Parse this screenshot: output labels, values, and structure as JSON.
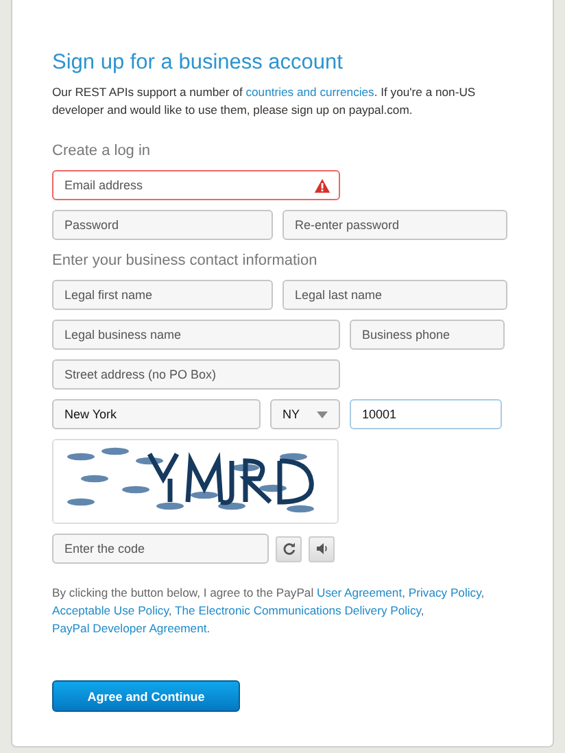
{
  "title": "Sign up for a business account",
  "intro": [
    {
      "kind": "text",
      "text": "Our REST APIs support a number of "
    },
    {
      "kind": "link",
      "text": "countries and currencies"
    },
    {
      "kind": "text",
      "text": ". If you're a non-US developer and would like to use them, please sign up on paypal.com."
    }
  ],
  "sections": [
    {
      "heading": "Create a log in",
      "rows": [
        [
          {
            "kind": "input",
            "placeholder": "Email address",
            "error": true,
            "focused": false
          }
        ],
        [
          {
            "kind": "input",
            "placeholder": "Password",
            "error": false,
            "focused": false
          },
          {
            "kind": "input",
            "placeholder": "Re-enter password",
            "error": false,
            "focused": false
          }
        ]
      ]
    },
    {
      "heading": "Enter your business contact information",
      "rows": [
        [
          {
            "kind": "input",
            "placeholder": "Legal first name",
            "error": false,
            "focused": false
          },
          {
            "kind": "input",
            "placeholder": "Legal last name",
            "error": false,
            "focused": false
          }
        ],
        [
          {
            "kind": "input",
            "placeholder": "Legal business name",
            "error": false,
            "focused": false
          },
          {
            "kind": "input",
            "placeholder": "Business phone",
            "error": false,
            "focused": false
          }
        ],
        [
          {
            "kind": "input",
            "placeholder": "Street address (no PO Box)",
            "error": false,
            "focused": false
          }
        ],
        [
          {
            "kind": "input",
            "value": "New York",
            "error": false,
            "focused": false
          },
          {
            "kind": "select",
            "value": "NY",
            "error": false,
            "focused": false
          },
          {
            "kind": "input",
            "value": "10001",
            "error": false,
            "focused": true
          }
        ]
      ]
    }
  ],
  "captcha": {
    "code_field": {
      "placeholder": "Enter the code"
    }
  },
  "terms": [
    {
      "kind": "text",
      "text": "By clicking the button below, I agree to the PayPal "
    },
    {
      "kind": "link",
      "text": "User Agreement"
    },
    {
      "kind": "text",
      "text": ", "
    },
    {
      "kind": "link",
      "text": "Privacy Policy"
    },
    {
      "kind": "text",
      "text": ", "
    },
    {
      "kind": "link",
      "text": "Acceptable Use Policy"
    },
    {
      "kind": "text",
      "text": ", "
    },
    {
      "kind": "link",
      "text": "The Electronic Communications Delivery Policy"
    },
    {
      "kind": "text",
      "text": ", "
    },
    {
      "kind": "link",
      "text": "PayPal Developer Agreement"
    },
    {
      "kind": "text",
      "text": "."
    }
  ],
  "submit": "Agree and Continue"
}
